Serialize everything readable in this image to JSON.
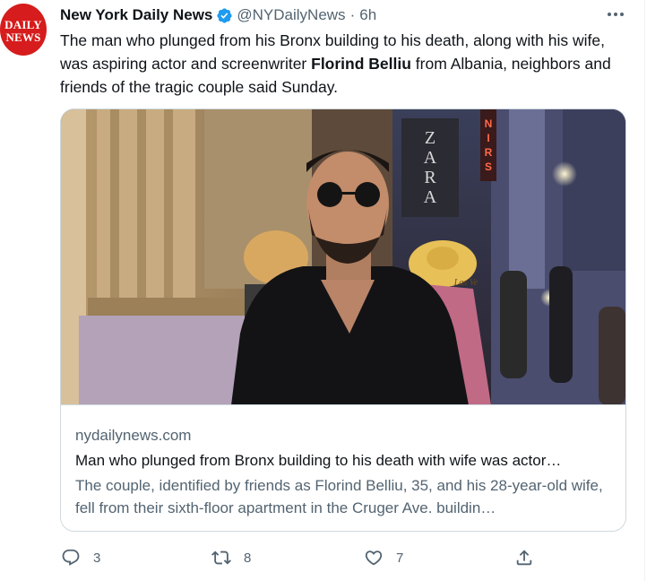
{
  "author": {
    "name": "New York Daily News",
    "handle": "@NYDailyNews",
    "separator": "·",
    "time": "6h",
    "avatar_lines": [
      "DAILY",
      "NEWS"
    ],
    "verified": true
  },
  "tweet": {
    "text_before": "The man who plunged from his Bronx building to his death, along with his wife, was aspiring actor and screenwriter ",
    "text_bold": "Florind Belliu",
    "text_after": " from Albania, neighbors and friends of the tragic couple said Sunday."
  },
  "card": {
    "domain": "nydailynews.com",
    "title": "Man who plunged from Bronx building to his death with wife was actor…",
    "description": "The couple, identified by friends as Florind Belliu, 35, and his 28-year-old wife, fell from their sixth-floor apartment in the Cruger Ave. buildin…",
    "image_signs": {
      "zara": [
        "Z",
        "A",
        "R",
        "A"
      ],
      "neon": [
        "N",
        "I",
        "R",
        "S"
      ],
      "hat_text": "Las Ve"
    }
  },
  "actions": {
    "reply_count": "3",
    "retweet_count": "8",
    "like_count": "7"
  },
  "icons": {
    "more": "more-icon",
    "verified": "verified-badge-icon",
    "reply": "reply-icon",
    "retweet": "retweet-icon",
    "like": "like-icon",
    "share": "share-icon"
  },
  "colors": {
    "text": "#0f1419",
    "secondary": "#536471",
    "verified": "#1d9bf0",
    "avatar_bg": "#d61c1c",
    "border": "#cfd9de"
  }
}
